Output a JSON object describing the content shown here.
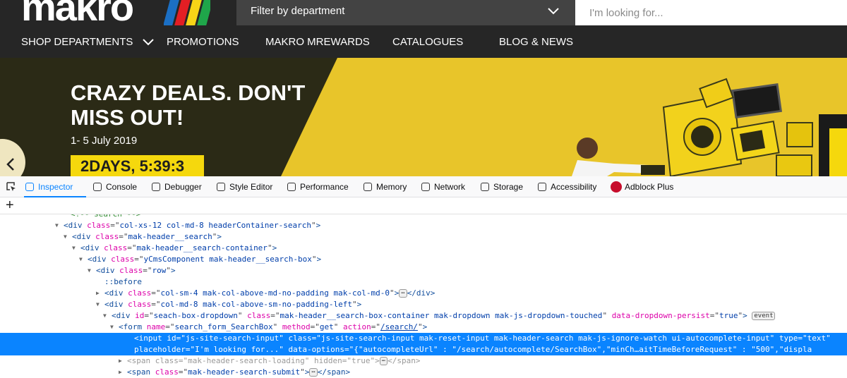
{
  "site": {
    "logo_text": "makro",
    "stripe_colors": [
      "#1b6fc4",
      "#e31e24",
      "#f7d417",
      "#1fa64a"
    ],
    "department_filter": "Filter by department",
    "search_placeholder": "I'm looking for...",
    "nav": [
      "SHOP DEPARTMENTS",
      "PROMOTIONS",
      "MAKRO MREWARDS",
      "CATALOGUES",
      "BLOG & NEWS"
    ],
    "banner": {
      "headline": "CRAZY DEALS. DON'T MISS OUT!",
      "dates": "1- 5 July 2019",
      "countdown": "2DAYS, 5:39:3"
    }
  },
  "devtools": {
    "tabs": [
      "Inspector",
      "Console",
      "Debugger",
      "Style Editor",
      "Performance",
      "Memory",
      "Network",
      "Storage",
      "Accessibility",
      "Adblock Plus"
    ],
    "active_tab": "Inspector",
    "accent": "#0a84ff",
    "lines": [
      {
        "t": "",
        "c": "<!-- search -->"
      },
      {
        "t": "open",
        "tag": "div",
        "attrs": [
          [
            "class",
            "col-xs-12 col-md-8 headerContainer-search"
          ]
        ],
        "close": ">"
      },
      {
        "t": "open",
        "tag": "div",
        "attrs": [
          [
            "class",
            "mak-header__search"
          ]
        ],
        "close": ">"
      },
      {
        "t": "open",
        "tag": "div",
        "attrs": [
          [
            "class",
            "mak-header__search-container"
          ]
        ],
        "close": ">"
      },
      {
        "t": "open",
        "tag": "div",
        "attrs": [
          [
            "class",
            "yCmsComponent mak-header__search-box"
          ]
        ],
        "close": ">"
      },
      {
        "t": "open",
        "tag": "div",
        "attrs": [
          [
            "class",
            "row"
          ]
        ],
        "close": ">"
      },
      {
        "t": "",
        "pseudo": "::before"
      },
      {
        "t": "closed",
        "tag": "div",
        "attrs": [
          [
            "class",
            "col-sm-4 mak-col-above-md-no-padding mak-col-md-0"
          ]
        ],
        "close": ">",
        "collapsed": "⋯",
        "end": "</div>"
      },
      {
        "t": "open",
        "tag": "div",
        "attrs": [
          [
            "class",
            "col-md-8 mak-col-above-sm-no-padding-left"
          ]
        ],
        "close": ">"
      },
      {
        "t": "open",
        "tag": "div",
        "attrs": [
          [
            "id",
            "seach-box-dropdown"
          ],
          [
            "class",
            "mak-header__search-box-container mak-dropdown mak-js-dropdown-touched"
          ],
          [
            "data-dropdown-persist",
            "true"
          ]
        ],
        "close": ">",
        "badge": "event"
      },
      {
        "t": "open",
        "tag": "form",
        "attrs": [
          [
            "name",
            "search_form_SearchBox"
          ],
          [
            "method",
            "get"
          ],
          [
            "action",
            "/search/"
          ]
        ],
        "close": ">"
      },
      {
        "t": "",
        "selected": true,
        "text": "<input id=\"js-site-search-input\" class=\"js-site-search-input mak-reset-input mak-header-search mak-js-ignore-watch ui-autocomplete-input\" type=\"text\""
      },
      {
        "t": "",
        "selected": true,
        "text": "placeholder=\"I'm looking for...\" data-options=\"{\"autocompleteUrl\" : \"/search/autocomplete/SearchBox\",\"minCh…aitTimeBeforeRequest\" : \"500\",\"displa"
      },
      {
        "t": "closed",
        "dim": true,
        "tag": "span",
        "attrs": [
          [
            "class",
            "mak-header-search-loading"
          ],
          [
            "hidden",
            "true"
          ]
        ],
        "close": ">",
        "collapsed": "⋯",
        "end": "</span>"
      },
      {
        "t": "closed",
        "tag": "span",
        "attrs": [
          [
            "class",
            "mak-header-search-submit"
          ]
        ],
        "close": ">",
        "collapsed": "⋯",
        "end": "</span>"
      }
    ]
  }
}
